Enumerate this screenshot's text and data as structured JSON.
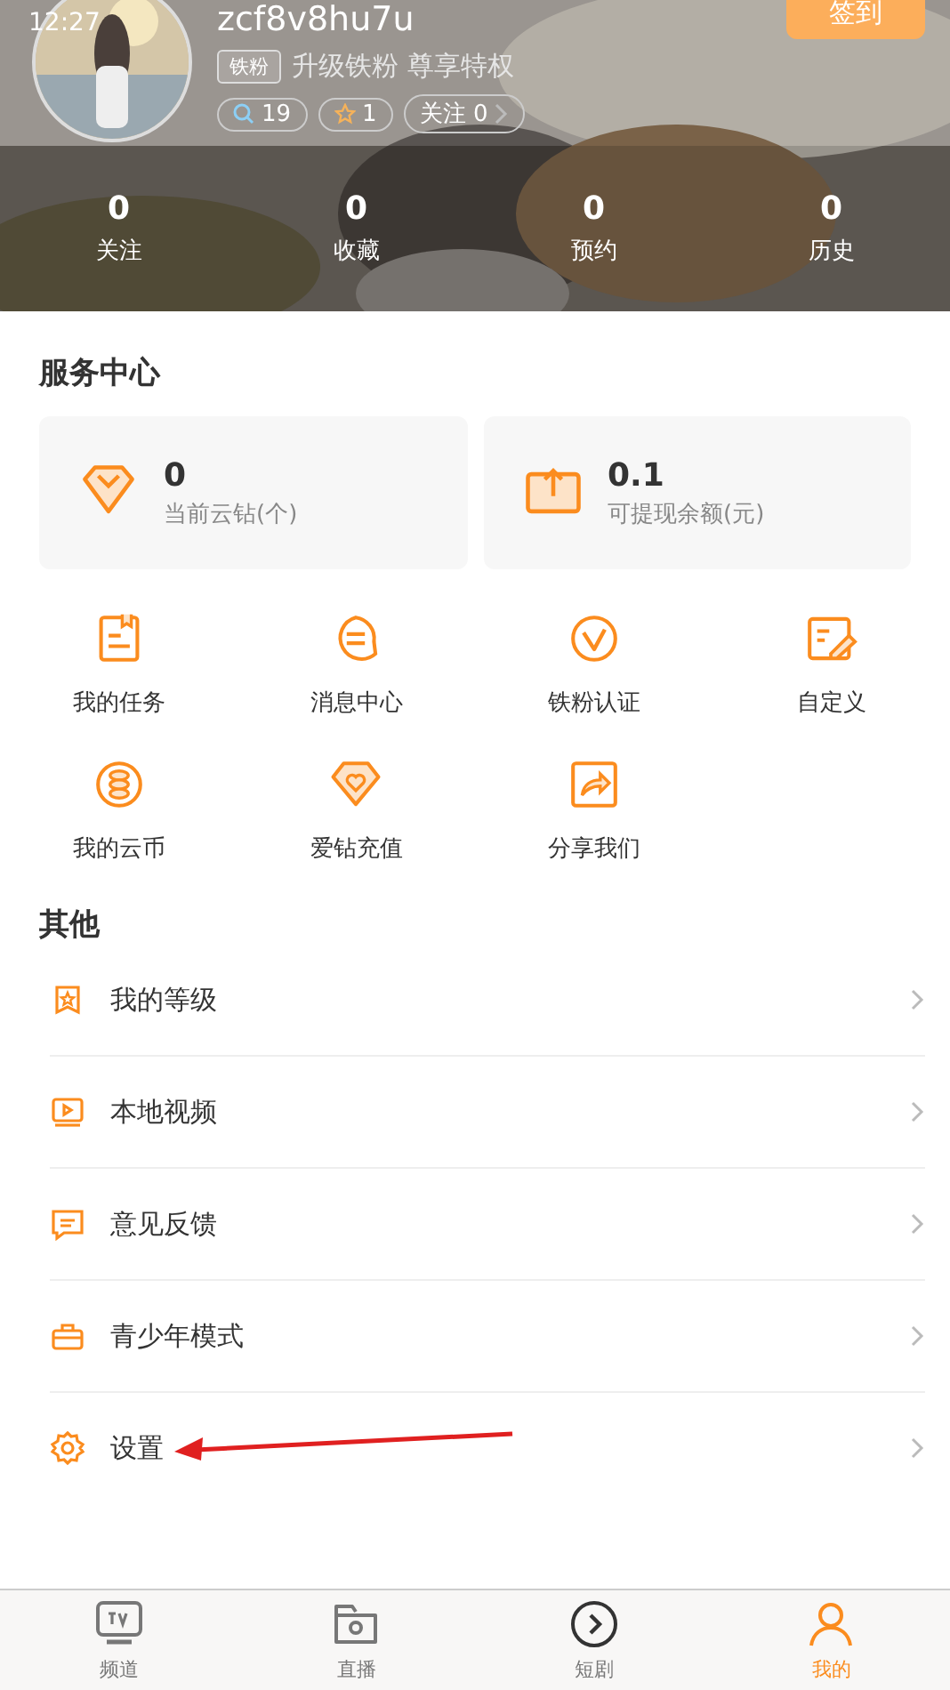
{
  "status_bar": {
    "time": "12:27"
  },
  "profile": {
    "username": "zcf8v8hu7u",
    "badge": "铁粉",
    "upgrade": "升级铁粉  尊享特权",
    "pills": [
      {
        "kind": "search",
        "text": "19"
      },
      {
        "kind": "star",
        "text": "1"
      },
      {
        "kind": "follow",
        "text": "关注 0"
      }
    ],
    "checkin": "签到"
  },
  "stats": [
    {
      "value": "0",
      "label": "关注"
    },
    {
      "value": "0",
      "label": "收藏"
    },
    {
      "value": "0",
      "label": "预约"
    },
    {
      "value": "0",
      "label": "历史"
    }
  ],
  "service": {
    "title": "服务中心",
    "cards": [
      {
        "kind": "diamond",
        "value": "0",
        "label": "当前云钻(个)"
      },
      {
        "kind": "withdraw",
        "value": "0.1",
        "label": "可提现余额(元)"
      }
    ],
    "items": [
      {
        "kind": "task",
        "label": "我的任务"
      },
      {
        "kind": "message",
        "label": "消息中心"
      },
      {
        "kind": "fan",
        "label": "铁粉认证"
      },
      {
        "kind": "edit",
        "label": "自定义"
      },
      {
        "kind": "coin",
        "label": "我的云币"
      },
      {
        "kind": "heart",
        "label": "爱钻充值"
      },
      {
        "kind": "share",
        "label": "分享我们"
      }
    ]
  },
  "other": {
    "title": "其他",
    "items": [
      {
        "kind": "level",
        "label": "我的等级"
      },
      {
        "kind": "video",
        "label": "本地视频"
      },
      {
        "kind": "feedback",
        "label": "意见反馈"
      },
      {
        "kind": "teen",
        "label": "青少年模式"
      },
      {
        "kind": "settings",
        "label": "设置",
        "annotated": true
      }
    ]
  },
  "tabs": [
    {
      "kind": "tv",
      "label": "频道",
      "selected": false
    },
    {
      "kind": "live",
      "label": "直播",
      "selected": false
    },
    {
      "kind": "play",
      "label": "短剧",
      "selected": false
    },
    {
      "kind": "user",
      "label": "我的",
      "selected": true
    }
  ]
}
